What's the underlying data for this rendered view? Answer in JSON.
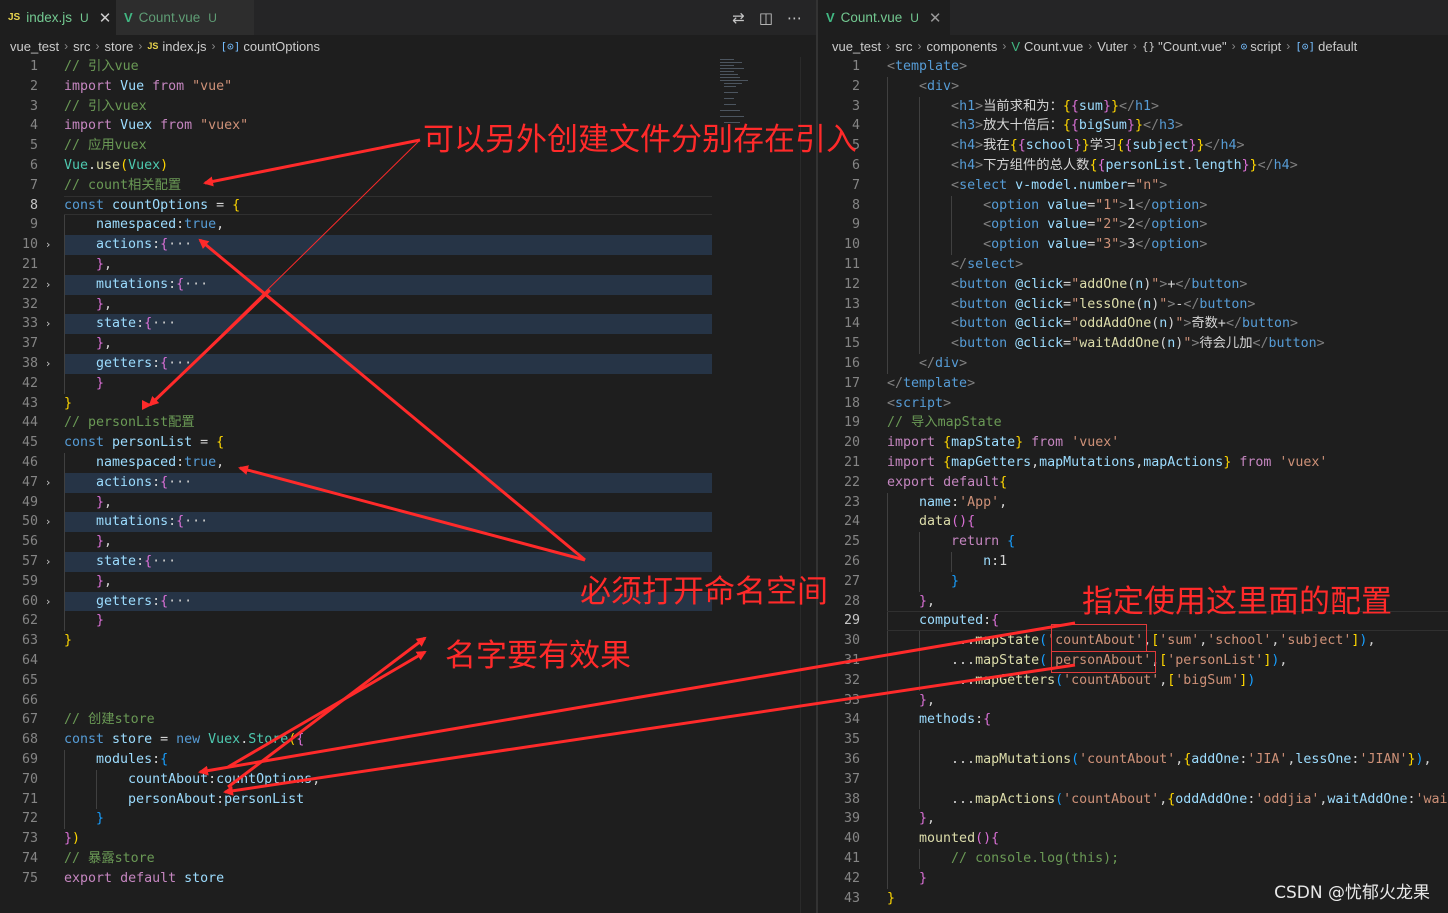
{
  "left_pane": {
    "tabs": [
      {
        "icon": "JS",
        "name": "index.js",
        "status": "U",
        "close": "✕",
        "active": true
      },
      {
        "icon": "V",
        "name": "Count.vue",
        "status": "U",
        "close": "",
        "active": false
      }
    ],
    "breadcrumb": [
      "vue_test",
      "src",
      "store",
      "index.js",
      "countOptions"
    ],
    "toolbar_icons": [
      "compare-changes-icon",
      "split-editor-icon",
      "more-actions-icon"
    ]
  },
  "right_pane": {
    "tabs": [
      {
        "icon": "V",
        "name": "Count.vue",
        "status": "U",
        "close": "✕",
        "active": true
      }
    ],
    "breadcrumb": [
      "vue_test",
      "src",
      "components",
      "Count.vue",
      "Vuter",
      "\"Count.vue\"",
      "script",
      "default"
    ]
  },
  "left_line_numbers": [
    "1",
    "2",
    "3",
    "4",
    "5",
    "6",
    "7",
    "8",
    "9",
    "10",
    "21",
    "22",
    "32",
    "33",
    "37",
    "38",
    "42",
    "43",
    "44",
    "45",
    "46",
    "47",
    "49",
    "50",
    "56",
    "57",
    "59",
    "60",
    "62",
    "63",
    "64",
    "65",
    "66",
    "67",
    "68",
    "69",
    "70",
    "71",
    "72",
    "73",
    "74",
    "75"
  ],
  "right_line_numbers": [
    "1",
    "2",
    "3",
    "4",
    "5",
    "6",
    "7",
    "8",
    "9",
    "10",
    "11",
    "12",
    "13",
    "14",
    "15",
    "16",
    "17",
    "18",
    "19",
    "20",
    "21",
    "22",
    "23",
    "24",
    "25",
    "26",
    "27",
    "28",
    "29",
    "30",
    "31",
    "32",
    "33",
    "34",
    "35",
    "36",
    "37",
    "38",
    "39",
    "40",
    "41",
    "42",
    "43"
  ],
  "left_current_line": "8",
  "right_current_line": "29",
  "annotations": {
    "separate_files": "可以另外创建文件分别存在引入",
    "namespace_required": "必须打开命名空间",
    "name_effective": "名字要有效果",
    "use_config": "指定使用这里面的配置"
  },
  "watermark": "CSDN @忧郁火龙果",
  "colors": {
    "annotation": "#ff2a2a",
    "background": "#1e1e1e",
    "tab_modified": "#73c991"
  }
}
